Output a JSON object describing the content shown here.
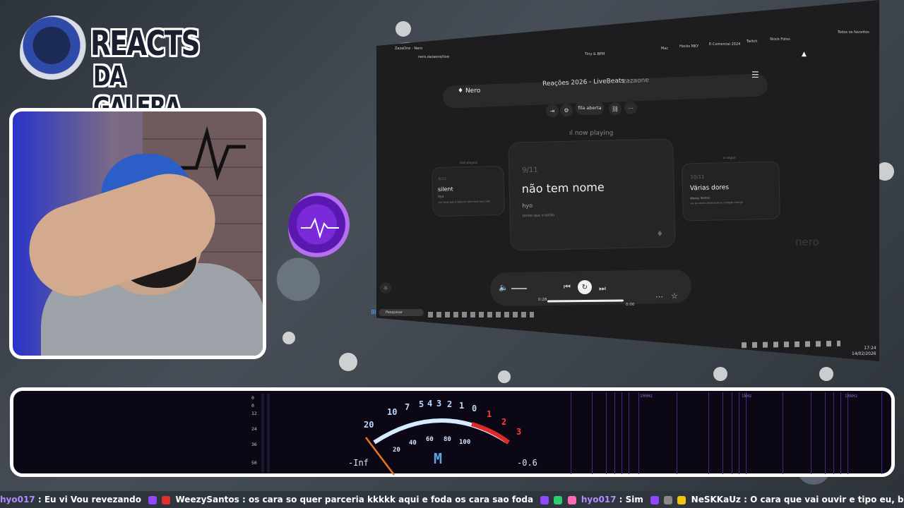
{
  "logo": {
    "line1": "REACTS",
    "line2": "DA GALERA"
  },
  "browser": {
    "tabs": {
      "tab_title": "ZazaOne - Nero"
    },
    "address": "nero.zazaone/live",
    "bookmarks": [
      "Tiny & BPM",
      "Mac",
      "Hacks MKY",
      "E-Comercial 2024",
      "Twitch",
      "Stock Fotos",
      "Todos os favoritos"
    ],
    "app": {
      "brand": "Nero",
      "title": "Reações 2026 - LiveBeats",
      "separator": "·",
      "user": "zazaone",
      "queue_button": "fila aberta",
      "now_playing_label": "now playing",
      "watermark": "nero"
    },
    "cards": {
      "left": {
        "caption": "last played",
        "index": "8/11",
        "title": "silent",
        "artist": "hyo",
        "lyric": "um sinal que o silêncio fala mais que tudo"
      },
      "middle": {
        "index": "9/11",
        "title": "não tem nome",
        "artist": "hyo",
        "lyric": "tenho que o estão"
      },
      "right": {
        "caption": "a seguir",
        "index": "10/11",
        "title": "Várias dores",
        "artist": "Weezy Santos",
        "lyric": "vai as várias dores que eu carrego comigo"
      }
    },
    "player": {
      "elapsed": "0:28",
      "remaining": "0:00"
    },
    "taskbar": {
      "search_placeholder": "Pesquisar",
      "time": "17:24",
      "date": "14/02/2026"
    }
  },
  "meter": {
    "db_scale": [
      "0",
      "0",
      "12",
      "24",
      "36",
      "50"
    ],
    "vu_scale_low": [
      "20",
      "10",
      "7",
      "5",
      "4",
      "3",
      "2",
      "1",
      "0"
    ],
    "vu_scale_high": [
      "1",
      "2",
      "3"
    ],
    "vu_pct": [
      "20",
      "40",
      "60",
      "80",
      "100"
    ],
    "left_value": "-Inf",
    "mode": "M",
    "right_value": "-0.6",
    "freq_labels": [
      "100Hz",
      "1kHz",
      "10kHz"
    ]
  },
  "chat": [
    {
      "user": "hyo017",
      "message": "Eu vi  Vou revezando"
    },
    {
      "user": "WeezySantos",
      "message": "os cara so quer parceria kkkkk  aqui e foda  os cara sao foda"
    },
    {
      "user": "hyo017",
      "message": "Sim"
    },
    {
      "user": "NeSKKaUz",
      "message": "O cara que vai ouvir e tipo eu, bebi e fuma todo dia do nada"
    }
  ]
}
